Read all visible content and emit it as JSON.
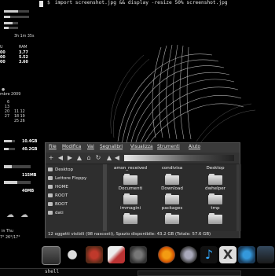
{
  "terminal": {
    "prompt": "$",
    "command": "import screenshot.jpg && display -resize 50% screenshot.jpg"
  },
  "conky": {
    "uptime": "3h 1m 35s",
    "cpu_header": "U",
    "ram_header": "RAM",
    "rows": [
      {
        "cpu": "00",
        "ram": "3.77"
      },
      {
        "cpu": "00",
        "ram": "5.52"
      },
      {
        "cpu": "00",
        "ram": "3.60"
      }
    ],
    "date_line": "mbre 2009",
    "calendar": [
      "6",
      "13",
      "20",
      "27",
      "11 12",
      "18 19",
      "25 26"
    ],
    "disk1": "10.4GB",
    "disk2": "40.2GB",
    "mem1": "115MB",
    "mem2": "40MB",
    "weather_days": "in   Thu",
    "weather_temps": "7° 26°/17°",
    "bar_fills": [
      0.55,
      0.25,
      0.35,
      0.6,
      0.3,
      0.5,
      0.7
    ]
  },
  "file_manager": {
    "menu": [
      "File",
      "Modifica",
      "Vai",
      "Segnalibri",
      "Visualizza",
      "Strumenti",
      "Aiuto"
    ],
    "sidebar": [
      "Desktop",
      "Lettore Floppy",
      "HOME",
      "ROOT",
      "BOOT",
      "dati"
    ],
    "files": [
      {
        "name": "amsn_received"
      },
      {
        "name": "condivisa"
      },
      {
        "name": "Desktop"
      },
      {
        "name": "Documenti"
      },
      {
        "name": "Download"
      },
      {
        "name": "dwhelper"
      },
      {
        "name": "immagini"
      },
      {
        "name": "packages"
      },
      {
        "name": "tmp"
      }
    ],
    "status": "12 oggetti visibili (98 nascosti), Spazio disponibile: 43.2 GB (Totale: 57.6 GB)"
  },
  "taskbar": {
    "shell_label": "shell"
  },
  "dock_icons": [
    "screen-icon",
    "alien-icon",
    "mario-icon",
    "rocket-icon",
    "gear-icon",
    "firefox-icon",
    "globe-icon",
    "music-icon",
    "xchat-icon",
    "tools-icon",
    "clapper-icon"
  ]
}
